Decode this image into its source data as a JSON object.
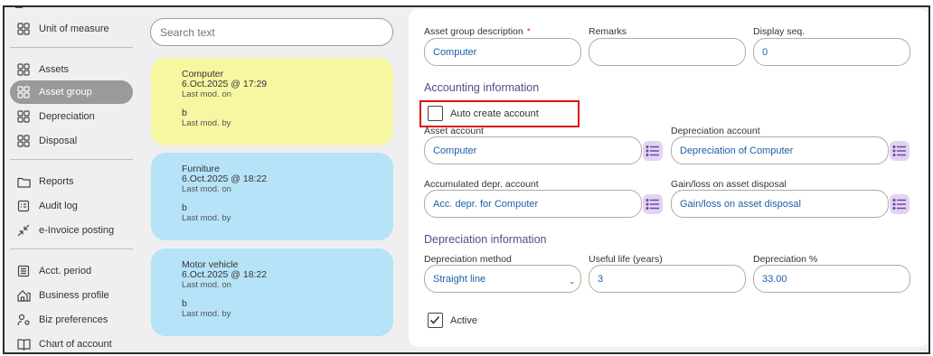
{
  "sidebar": {
    "items": [
      {
        "label": "Unit of measure",
        "icon": "grid-icon"
      },
      {
        "label": "Assets",
        "icon": "grid-icon"
      },
      {
        "label": "Asset group",
        "icon": "grid-icon",
        "active": true
      },
      {
        "label": "Depreciation",
        "icon": "grid-icon"
      },
      {
        "label": "Disposal",
        "icon": "grid-icon"
      },
      {
        "label": "Reports",
        "icon": "folder-icon"
      },
      {
        "label": "Audit log",
        "icon": "log-icon"
      },
      {
        "label": "e-Invoice posting",
        "icon": "arrows-icon"
      },
      {
        "label": "Acct. period",
        "icon": "list-icon"
      },
      {
        "label": "Business profile",
        "icon": "house-icon"
      },
      {
        "label": "Biz preferences",
        "icon": "user-gear-icon"
      },
      {
        "label": "Chart of account",
        "icon": "book-icon"
      }
    ]
  },
  "search": {
    "placeholder": "Search text"
  },
  "records": [
    {
      "name": "Computer",
      "date": "6.Oct.2025 @ 17:29",
      "mod_on_label": "Last mod. on",
      "user": "b",
      "mod_by_label": "Last mod. by",
      "color": "#f7f7a2"
    },
    {
      "name": "Furniture",
      "date": "6.Oct.2025 @ 18:22",
      "mod_on_label": "Last mod. on",
      "user": "b",
      "mod_by_label": "Last mod. by",
      "color": "#b6e3f7"
    },
    {
      "name": "Motor vehicle",
      "date": "6.Oct.2025 @ 18:22",
      "mod_on_label": "Last mod. on",
      "user": "b",
      "mod_by_label": "Last mod. by",
      "color": "#b6e3f7"
    }
  ],
  "form": {
    "description_label": "Asset group description",
    "required_mark": "*",
    "description_value": "Computer",
    "remarks_label": "Remarks",
    "remarks_value": "",
    "display_seq_label": "Display seq.",
    "display_seq_value": "0",
    "accounting_title": "Accounting information",
    "auto_create_label": "Auto create account",
    "auto_create_checked": false,
    "asset_account_label": "Asset account",
    "asset_account_value": "Computer",
    "depreciation_account_label": "Depreciation account",
    "depreciation_account_value": "Depreciation of Computer",
    "accum_depr_label": "Accumulated depr. account",
    "accum_depr_value": "Acc. depr. for Computer",
    "gain_loss_label": "Gain/loss on asset disposal",
    "gain_loss_value": "Gain/loss on asset disposal",
    "depreciation_title": "Depreciation information",
    "method_label": "Depreciation method",
    "method_value": "Straight line",
    "useful_life_label": "Useful life (years)",
    "useful_life_value": "3",
    "depr_pct_label": "Depreciation %",
    "depr_pct_value": "33.00",
    "active_label": "Active",
    "active_checked": true
  },
  "colors": {
    "accent": "#5a4a8a",
    "value_text": "#1d5fa8",
    "highlight": "#e01010",
    "list_button": "#e3d3f3"
  }
}
